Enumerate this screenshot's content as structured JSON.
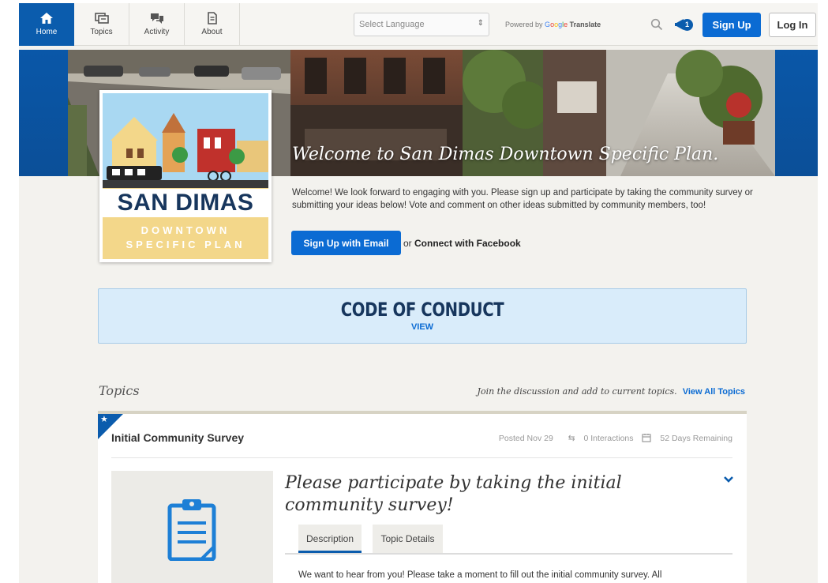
{
  "nav": {
    "items": [
      {
        "label": "Home",
        "icon": "house-icon"
      },
      {
        "label": "Topics",
        "icon": "topics-icon"
      },
      {
        "label": "Activity",
        "icon": "chat-bubbles-icon"
      },
      {
        "label": "About",
        "icon": "document-icon"
      }
    ],
    "language_select": "Select Language",
    "powered_by": "Powered by",
    "translate": "Translate",
    "notification_count": "1",
    "signup_label": "Sign Up",
    "login_label": "Log In"
  },
  "hero": {
    "title": "Welcome to San Dimas Downtown Specific Plan."
  },
  "logo": {
    "name": "SAN DIMAS",
    "line1": "DOWNTOWN",
    "line2": "SPECIFIC PLAN"
  },
  "welcome": {
    "text": "Welcome! We look forward to engaging with you. Please sign up and participate by taking the community survey or submitting your ideas below! Vote and comment on other ideas submitted by community members, too!",
    "email_button": "Sign Up with Email",
    "or": "or",
    "facebook": "Connect with Facebook"
  },
  "conduct": {
    "title": "CODE OF CONDUCT",
    "view": "VIEW"
  },
  "topics": {
    "heading": "Topics",
    "join_text": "Join the discussion and add to current topics.",
    "view_all": "View All Topics",
    "card": {
      "title": "Initial Community Survey",
      "posted": "Posted Nov 29",
      "interactions": "0 Interactions",
      "remaining": "52 Days Remaining",
      "headline": "Please participate by taking the initial community survey!",
      "tabs": [
        "Description",
        "Topic Details"
      ],
      "description": "We want to hear from you! Please take a moment to fill out the initial community survey. All"
    }
  },
  "colors": {
    "brand_blue": "#0b5cad",
    "button_blue": "#0b6bd3",
    "conduct_bg": "#d9ecfa"
  }
}
